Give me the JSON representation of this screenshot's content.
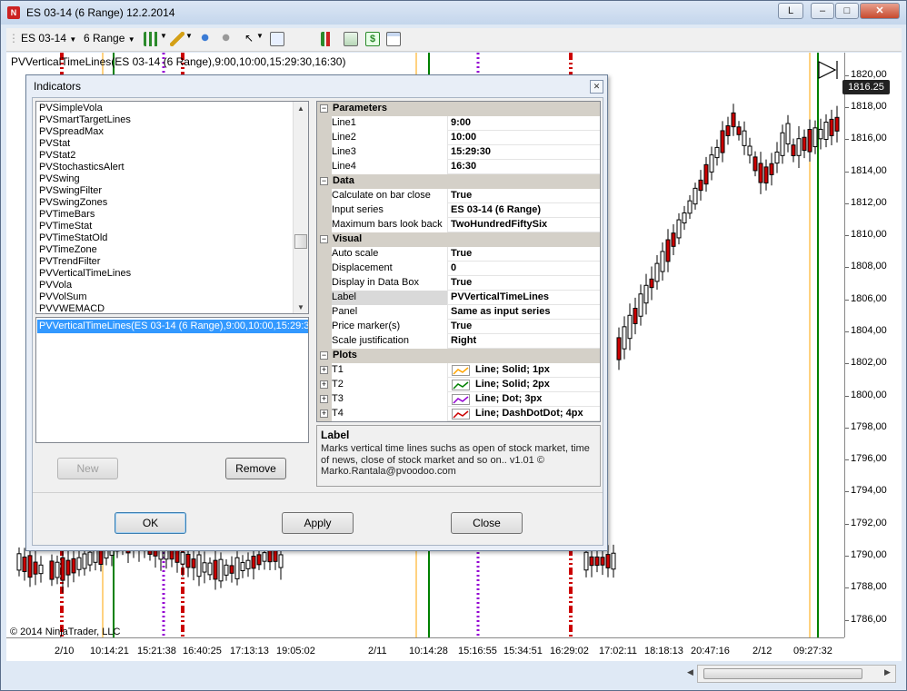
{
  "window": {
    "title": "ES 03-14 (6 Range)  12.2.2014",
    "buttons": [
      "L",
      "–",
      "□",
      "✕"
    ]
  },
  "toolbar": {
    "instrument": "ES 03-14",
    "period": "6 Range"
  },
  "chart": {
    "indicator_label": "PVVerticalTimeLines(ES 03-14 (6 Range),9:00,10:00,15:29:30,16:30)",
    "copyright": "© 2014 NinjaTrader, LLC",
    "last_price": "1816.25",
    "colors": {
      "line1": "#ffa500",
      "line2": "#008000",
      "line3": "#9400d3",
      "line4": "#cc0000",
      "bull": "#ffffff",
      "bear": "#cc0000"
    }
  },
  "chart_data": {
    "type": "candlestick",
    "y_ticks": [
      "1820,00",
      "1818,00",
      "1816,00",
      "1814,00",
      "1812,00",
      "1810,00",
      "1808,00",
      "1806,00",
      "1804,00",
      "1802,00",
      "1800,00",
      "1798,00",
      "1796,00",
      "1794,00",
      "1792,00",
      "1790,00",
      "1788,00",
      "1786,00"
    ],
    "ylim": [
      1784.9,
      1821.4
    ],
    "x_ticks": [
      "2/10",
      "10:14:21",
      "15:21:38",
      "16:40:25",
      "17:13:13",
      "19:05:02",
      "2/11",
      "10:14:28",
      "15:16:55",
      "15:34:51",
      "16:29:02",
      "17:02:11",
      "18:18:13",
      "20:47:16",
      "2/12",
      "09:27:32"
    ]
  },
  "dialog": {
    "title": "Indicators",
    "indicator_list": [
      "PVSimpleVola",
      "PVSmartTargetLines",
      "PVSpreadMax",
      "PVStat",
      "PVStat2",
      "PVStochasticsAlert",
      "PVSwing",
      "PVSwingFilter",
      "PVSwingZones",
      "PVTimeBars",
      "PVTimeStat",
      "PVTimeStatOld",
      "PVTimeZone",
      "PVTrendFilter",
      "PVVerticalTimeLines",
      "PVVola",
      "PVVolSum",
      "PVVWEMACD"
    ],
    "selected_indicator": "PVVerticalTimeLines(ES 03-14 (6 Range),9:00,10:00,15:29:30,16:30)",
    "new_label": "New",
    "remove_label": "Remove",
    "ok_label": "OK",
    "apply_label": "Apply",
    "close_label": "Close",
    "categories": {
      "parameters": "Parameters",
      "data": "Data",
      "visual": "Visual",
      "plots": "Plots"
    },
    "parameters": [
      {
        "name": "Line1",
        "value": "9:00"
      },
      {
        "name": "Line2",
        "value": "10:00"
      },
      {
        "name": "Line3",
        "value": "15:29:30"
      },
      {
        "name": "Line4",
        "value": "16:30"
      }
    ],
    "data": [
      {
        "name": "Calculate on bar close",
        "value": "True"
      },
      {
        "name": "Input series",
        "value": "ES 03-14 (6 Range)"
      },
      {
        "name": "Maximum bars look back",
        "value": "TwoHundredFiftySix"
      }
    ],
    "visual": [
      {
        "name": "Auto scale",
        "value": "True"
      },
      {
        "name": "Displacement",
        "value": "0"
      },
      {
        "name": "Display in Data Box",
        "value": "True"
      },
      {
        "name": "Label",
        "value": "PVVerticalTimeLines"
      },
      {
        "name": "Panel",
        "value": "Same as input series"
      },
      {
        "name": "Price marker(s)",
        "value": "True"
      },
      {
        "name": "Scale justification",
        "value": "Right"
      }
    ],
    "plots": [
      {
        "name": "T1",
        "value": "Line; Solid; 1px",
        "color": "#ffa500"
      },
      {
        "name": "T2",
        "value": "Line; Solid; 2px",
        "color": "#008000"
      },
      {
        "name": "T3",
        "value": "Line; Dot; 3px",
        "color": "#9400d3"
      },
      {
        "name": "T4",
        "value": "Line; DashDotDot; 4px",
        "color": "#cc0000"
      }
    ],
    "description_title": "Label",
    "description_text": "Marks vertical time lines suchs as open of stock market, time of news, close of stock market and so on.. v1.01 © Marko.Rantala@pvoodoo.com"
  }
}
